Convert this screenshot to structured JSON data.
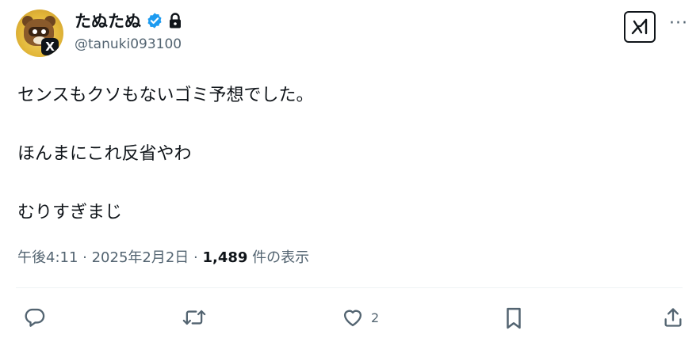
{
  "user": {
    "display_name": "たぬたぬ",
    "handle": "@tanuki093100",
    "verified": true,
    "protected": true,
    "avatar_badge": "X"
  },
  "tweet": {
    "lines": [
      "センスもクソもないゴミ予想でした。",
      "ほんまにこれ反省やわ",
      "むりすぎまじ"
    ]
  },
  "meta": {
    "time": "午後4:11",
    "separator": " · ",
    "date": "2025年2月2日",
    "views_count": "1,489",
    "views_suffix": " 件の表示"
  },
  "actions": {
    "reply_icon": "reply-icon",
    "retweet_icon": "retweet-icon",
    "like_icon": "heart-icon",
    "like_count": "2",
    "bookmark_icon": "bookmark-icon",
    "share_icon": "share-icon"
  },
  "colors": {
    "text": "#0f1419",
    "muted": "#536471",
    "verified_blue": "#1d9bf0",
    "divider": "#eff3f4"
  }
}
